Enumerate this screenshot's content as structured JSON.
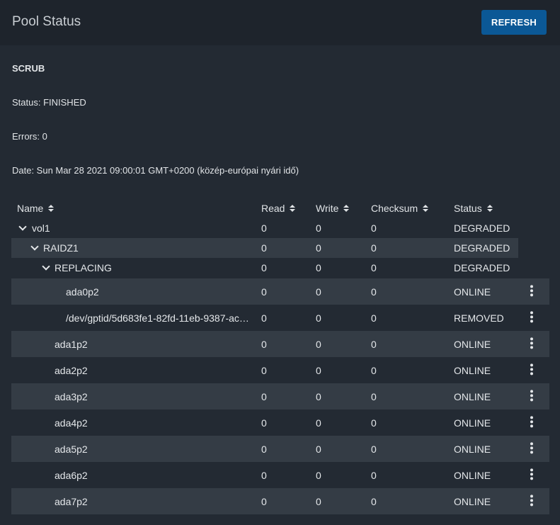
{
  "header": {
    "title": "Pool Status",
    "refresh_label": "REFRESH"
  },
  "scrub": {
    "heading": "SCRUB",
    "status": "Status: FINISHED",
    "errors": "Errors: 0",
    "date": "Date: Sun Mar 28 2021 09:00:01 GMT+0200 (közép-európai nyári idő)"
  },
  "table": {
    "columns": [
      "Name",
      "Read",
      "Write",
      "Checksum",
      "Status"
    ],
    "rows": [
      {
        "name": "vol1",
        "read": "0",
        "write": "0",
        "checksum": "0",
        "status": "DEGRADED"
      },
      {
        "name": "RAIDZ1",
        "read": "0",
        "write": "0",
        "checksum": "0",
        "status": "DEGRADED"
      },
      {
        "name": "REPLACING",
        "read": "0",
        "write": "0",
        "checksum": "0",
        "status": "DEGRADED"
      },
      {
        "name": "ada0p2",
        "read": "0",
        "write": "0",
        "checksum": "0",
        "status": "ONLINE"
      },
      {
        "name": "/dev/gptid/5d683fe1-82fd-11eb-9387-ac…",
        "read": "0",
        "write": "0",
        "checksum": "0",
        "status": "REMOVED"
      },
      {
        "name": "ada1p2",
        "read": "0",
        "write": "0",
        "checksum": "0",
        "status": "ONLINE"
      },
      {
        "name": "ada2p2",
        "read": "0",
        "write": "0",
        "checksum": "0",
        "status": "ONLINE"
      },
      {
        "name": "ada3p2",
        "read": "0",
        "write": "0",
        "checksum": "0",
        "status": "ONLINE"
      },
      {
        "name": "ada4p2",
        "read": "0",
        "write": "0",
        "checksum": "0",
        "status": "ONLINE"
      },
      {
        "name": "ada5p2",
        "read": "0",
        "write": "0",
        "checksum": "0",
        "status": "ONLINE"
      },
      {
        "name": "ada6p2",
        "read": "0",
        "write": "0",
        "checksum": "0",
        "status": "ONLINE"
      },
      {
        "name": "ada7p2",
        "read": "0",
        "write": "0",
        "checksum": "0",
        "status": "ONLINE"
      }
    ]
  },
  "icons": {
    "expand": "chevron-down-icon",
    "actions": "more-vert-icon",
    "sort": "sort-icon"
  }
}
